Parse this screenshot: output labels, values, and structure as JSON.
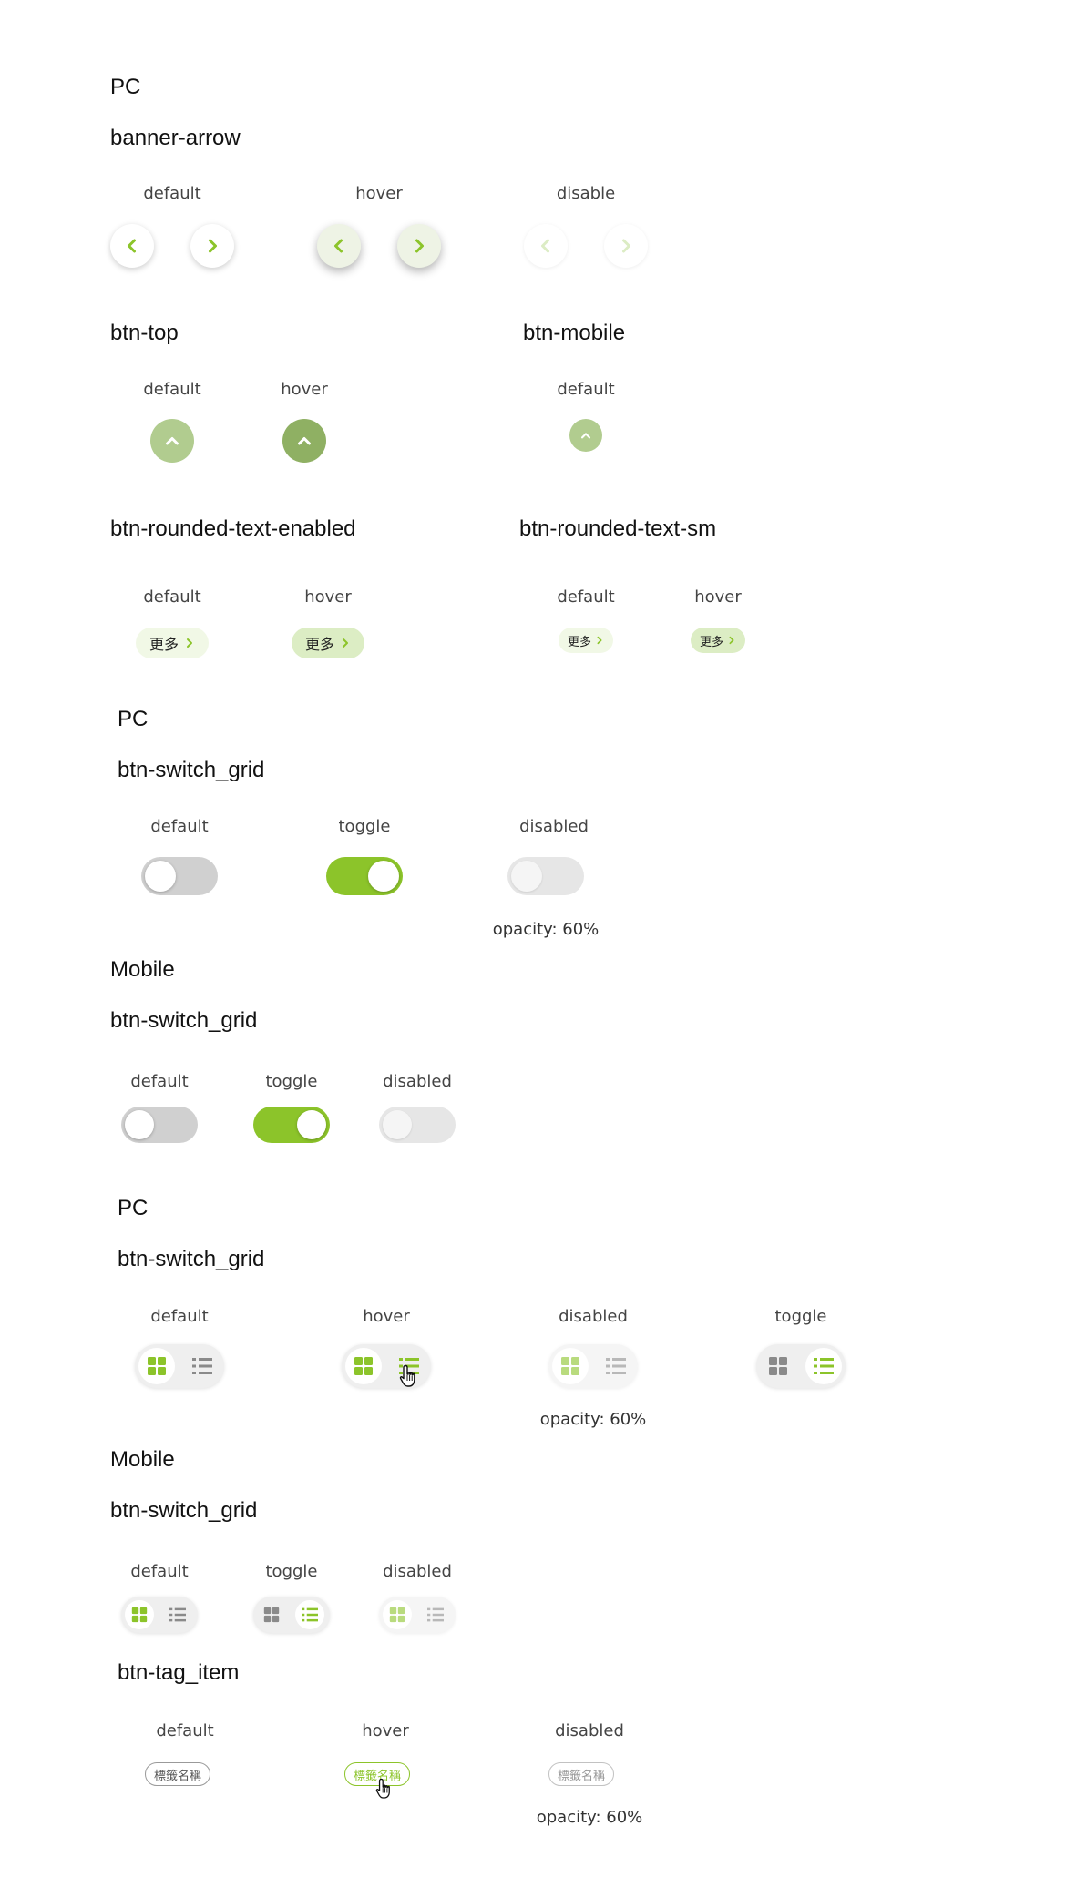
{
  "colors": {
    "accent": "#8cc42a",
    "accent_light": "#c8e29a",
    "top_default": "#b1cc8f",
    "top_hover": "#8fb063",
    "switch_off": "#d0d0d0",
    "switch_disabled": "#e6e6e6",
    "pill_default_bg": "#f1f8e6",
    "pill_hover_bg": "#dcedc4"
  },
  "section1": {
    "platform": "PC",
    "banner_arrow": {
      "title": "banner-arrow",
      "states": [
        "default",
        "hover",
        "disable"
      ]
    },
    "btn_top": {
      "title": "btn-top",
      "states": [
        "default",
        "hover"
      ]
    },
    "btn_mobile": {
      "title": "btn-mobile",
      "states": [
        "default"
      ]
    },
    "rounded_text_enabled": {
      "title": "btn-rounded-text-enabled",
      "states": [
        "default",
        "hover"
      ],
      "label": "更多"
    },
    "rounded_text_sm": {
      "title": "btn-rounded-text-sm",
      "states": [
        "default",
        "hover"
      ],
      "label": "更多"
    }
  },
  "section2": {
    "platform": "PC",
    "title": "btn-switch_grid",
    "states": [
      "default",
      "toggle",
      "disabled"
    ],
    "note": "opacity: 60%"
  },
  "section3": {
    "platform": "Mobile",
    "title": "btn-switch_grid",
    "states": [
      "default",
      "toggle",
      "disabled"
    ]
  },
  "section4": {
    "platform": "PC",
    "title": "btn-switch_grid",
    "states": [
      "default",
      "hover",
      "disabled",
      "toggle"
    ],
    "note": "opacity: 60%"
  },
  "section5": {
    "platform": "Mobile",
    "title": "btn-switch_grid",
    "states": [
      "default",
      "toggle",
      "disabled"
    ]
  },
  "section6": {
    "title": "btn-tag_item",
    "states": [
      "default",
      "hover",
      "disabled"
    ],
    "tag_label": "標籤名稱",
    "note": "opacity: 60%"
  },
  "icons": [
    "chevron-left-icon",
    "chevron-right-icon",
    "chevron-up-icon",
    "grid-icon",
    "list-icon",
    "hand-cursor-icon"
  ]
}
